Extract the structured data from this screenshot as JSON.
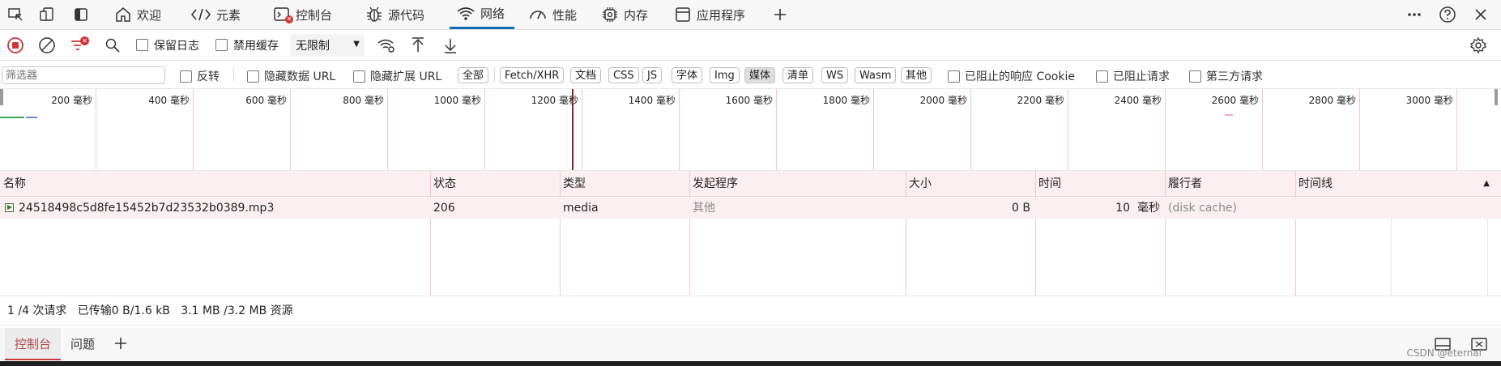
{
  "tabs": [
    {
      "label": "欢迎",
      "icon": "home-icon"
    },
    {
      "label": "元素",
      "icon": "code-brackets-icon"
    },
    {
      "label": "控制台",
      "icon": "console-icon"
    },
    {
      "label": "源代码",
      "icon": "bug-icon"
    },
    {
      "label": "网络",
      "icon": "wifi-icon",
      "active": true
    },
    {
      "label": "性能",
      "icon": "gauge-icon"
    },
    {
      "label": "内存",
      "icon": "chip-icon"
    },
    {
      "label": "应用程序",
      "icon": "app-window-icon"
    }
  ],
  "toolbar": {
    "preserve_log": "保留日志",
    "disable_cache": "禁用缓存",
    "throttle": "无限制"
  },
  "filter": {
    "placeholder": "筛选器",
    "invert": "反转",
    "hide_data_url": "隐藏数据 URL",
    "hide_ext_url": "隐藏扩展 URL",
    "chips": [
      "全部",
      "Fetch/XHR",
      "文档",
      "CSS",
      "JS",
      "字体",
      "Img",
      "媒体",
      "清单",
      "WS",
      "Wasm",
      "其他"
    ],
    "active_chip": "媒体",
    "blocked_cookies": "已阻止的响应 Cookie",
    "blocked_requests": "已阻止请求",
    "third_party": "第三方请求"
  },
  "overview": {
    "unit": "毫秒",
    "ticks": [
      "200",
      "400",
      "600",
      "800",
      "1000",
      "1200",
      "1400",
      "1600",
      "1800",
      "2000",
      "2200",
      "2400",
      "2600",
      "2800",
      "3000"
    ]
  },
  "grid": {
    "headers": [
      "名称",
      "状态",
      "类型",
      "发起程序",
      "大小",
      "时间",
      "履行者",
      "时间线"
    ],
    "rows": [
      {
        "name": "24518498c5d8fe15452b7d23532b0389.mp3",
        "status": "206",
        "type": "media",
        "initiator": "其他",
        "size": "0 B",
        "time": "10",
        "time_unit": "毫秒",
        "fulfilled": "(disk cache)"
      }
    ]
  },
  "status": {
    "requests": "1 /4 次请求",
    "transferred": "已传输0 B/1.6 kB",
    "resources": "3.1 MB /3.2 MB 资源"
  },
  "drawer": {
    "tabs": [
      "控制台",
      "问题"
    ]
  },
  "watermark": "CSDN @eternal",
  "colors": {
    "accent": "#0f6cbd",
    "record_red": "#d13438",
    "grid_header": "#fbeff1"
  }
}
